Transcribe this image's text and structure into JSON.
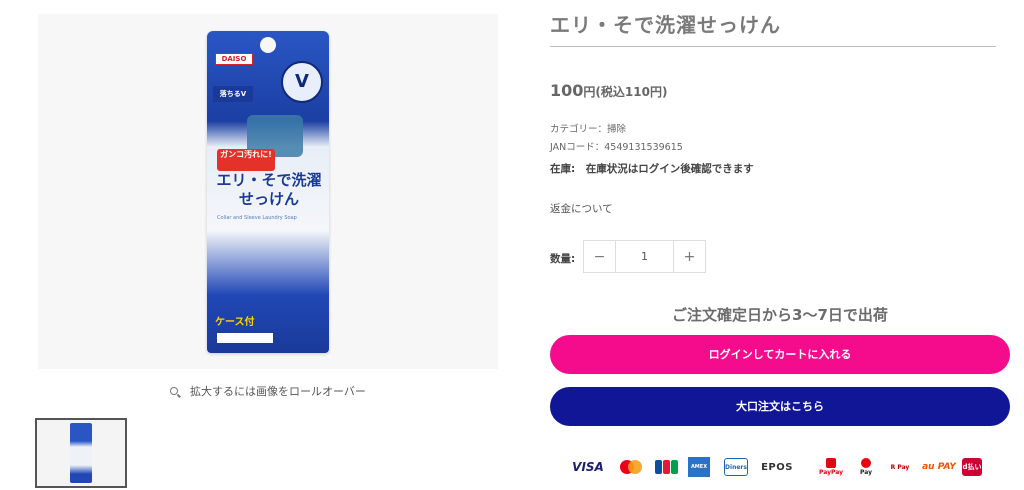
{
  "product": {
    "title": "エリ・そで洗濯せっけん",
    "price_value": "100",
    "price_suffix": "円(税込110円)",
    "category": "カテゴリー：掃除",
    "jan": "JANコード：4549131539615",
    "stock": "在庫:　在庫状況はログイン後確認できます",
    "refund_link": "返金について"
  },
  "image": {
    "zoom_hint": "拡大するには画像をロールオーバー",
    "package_brand": "DAISO",
    "package_badge": "落ちるV",
    "package_tag": "ガンコ汚れに!",
    "package_title": "エリ・そで洗濯せっけん",
    "package_subtitle": "Collar and Sleeve Laundry Soap",
    "package_case": "ケース付",
    "package_mascot": "V"
  },
  "quantity": {
    "label": "数量:",
    "value": "1",
    "minus": "−",
    "plus": "+"
  },
  "shipping": {
    "notice": "ご注文確定日から3〜7日で出荷"
  },
  "buttons": {
    "cart": "ログインしてカートに入れる",
    "bulk": "大口注文はこちら"
  },
  "payments": {
    "visa": "VISA",
    "epos": "EPOS",
    "paypay": "PayPay",
    "mpay": "Pay",
    "rpay": "R Pay",
    "aupay": "au PAY",
    "dpay": "d払い",
    "amex": "AMEX",
    "diners": "Diners"
  },
  "colors": {
    "cart_button": "#f40c8c",
    "bulk_button": "#101695",
    "title": "#7a7a7a"
  }
}
